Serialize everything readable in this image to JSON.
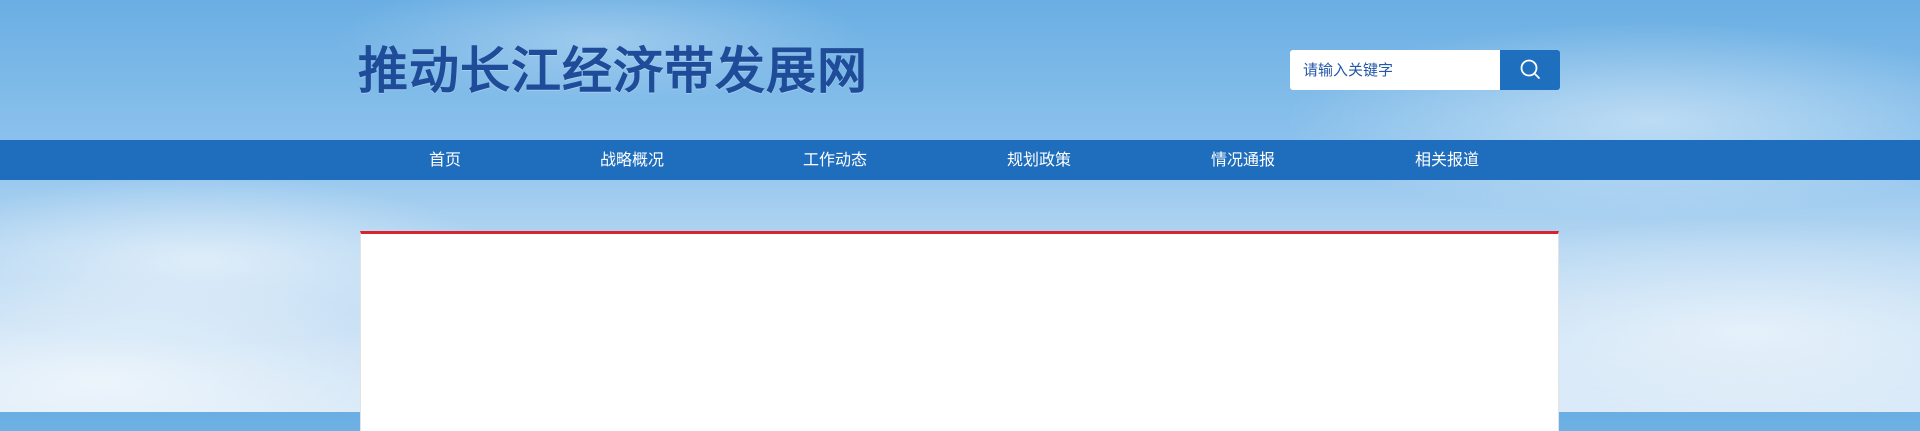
{
  "header": {
    "site_title": "推动长江经济带发展网"
  },
  "search": {
    "placeholder": "请输入关键字",
    "value": "",
    "button_icon": "search-icon"
  },
  "nav": {
    "items": [
      {
        "label": "首页"
      },
      {
        "label": "战略概况"
      },
      {
        "label": "工作动态"
      },
      {
        "label": "规划政策"
      },
      {
        "label": "情况通报"
      },
      {
        "label": "相关报道"
      }
    ]
  },
  "colors": {
    "nav_background": "#1f6ebd",
    "title": "#1f4c98",
    "panel_accent": "#d9242f",
    "search_button": "#1f6fbf"
  }
}
